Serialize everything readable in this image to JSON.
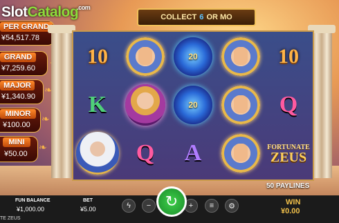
{
  "watermark": {
    "brand_left": "Slot",
    "brand_right": "Catalog",
    "tld": ".com"
  },
  "header": {
    "collect_prefix": "COLLECT ",
    "collect_number": "6",
    "collect_suffix": " OR MO"
  },
  "jackpots": [
    {
      "label": "PER GRAND",
      "value": "¥54,517.78"
    },
    {
      "label": "GRAND",
      "value": "¥7,259.60"
    },
    {
      "label": "MAJOR",
      "value": "¥1,340.90"
    },
    {
      "label": "MINOR",
      "value": "¥100.00"
    },
    {
      "label": "MINI",
      "value": "¥50.00"
    }
  ],
  "reels": {
    "symbols": [
      {
        "col": 0,
        "row": 0,
        "kind": "number",
        "text": "10"
      },
      {
        "col": 1,
        "row": 0,
        "kind": "fist",
        "icon": "lightning-fist-icon"
      },
      {
        "col": 2,
        "row": 0,
        "kind": "orb",
        "text": "20",
        "icon": "lightning-orb-icon"
      },
      {
        "col": 3,
        "row": 0,
        "kind": "fist",
        "icon": "lightning-fist-icon"
      },
      {
        "col": 4,
        "row": 0,
        "kind": "number",
        "text": "10"
      },
      {
        "col": 0,
        "row": 1,
        "kind": "letter",
        "text": "K",
        "color": "#4fd07a"
      },
      {
        "col": 1,
        "row": 1,
        "kind": "goddess",
        "icon": "goddess-portrait-icon"
      },
      {
        "col": 2,
        "row": 1,
        "kind": "orb",
        "text": "20",
        "icon": "lightning-orb-icon"
      },
      {
        "col": 3,
        "row": 1,
        "kind": "fist",
        "icon": "lightning-fist-icon"
      },
      {
        "col": 4,
        "row": 1,
        "kind": "letter",
        "text": "Q",
        "color": "#ff5aa0"
      },
      {
        "col": 0,
        "row": 2,
        "kind": "zeus",
        "icon": "zeus-portrait-icon"
      },
      {
        "col": 1,
        "row": 2,
        "kind": "letter",
        "text": "Q",
        "color": "#ff5aa0"
      },
      {
        "col": 2,
        "row": 2,
        "kind": "letter",
        "text": "A",
        "color": "#b07cff"
      },
      {
        "col": 3,
        "row": 2,
        "kind": "fist",
        "icon": "lightning-fist-icon"
      },
      {
        "col": 4,
        "row": 2,
        "kind": "logo",
        "line1": "FORTUNATE",
        "line2": "ZEUS"
      }
    ]
  },
  "paylines": "50 PAYLINES",
  "bottom_bar": {
    "balance_label": "FUN BALANCE",
    "balance_value": "¥1,000.00",
    "bet_label": "BET",
    "bet_value": "¥5.00",
    "win_label": "WIN",
    "win_value": "¥0.00",
    "icons": [
      "turbo-lightning-icon",
      "minus-icon",
      "spin-icon",
      "plus-icon",
      "autoplay-icon",
      "settings-icon"
    ]
  },
  "game_name": "TE ZEUS",
  "colors": {
    "accent_gold": "#f1c04a",
    "spin_green": "#3ed04a",
    "orb_text": "#ffe38a"
  }
}
